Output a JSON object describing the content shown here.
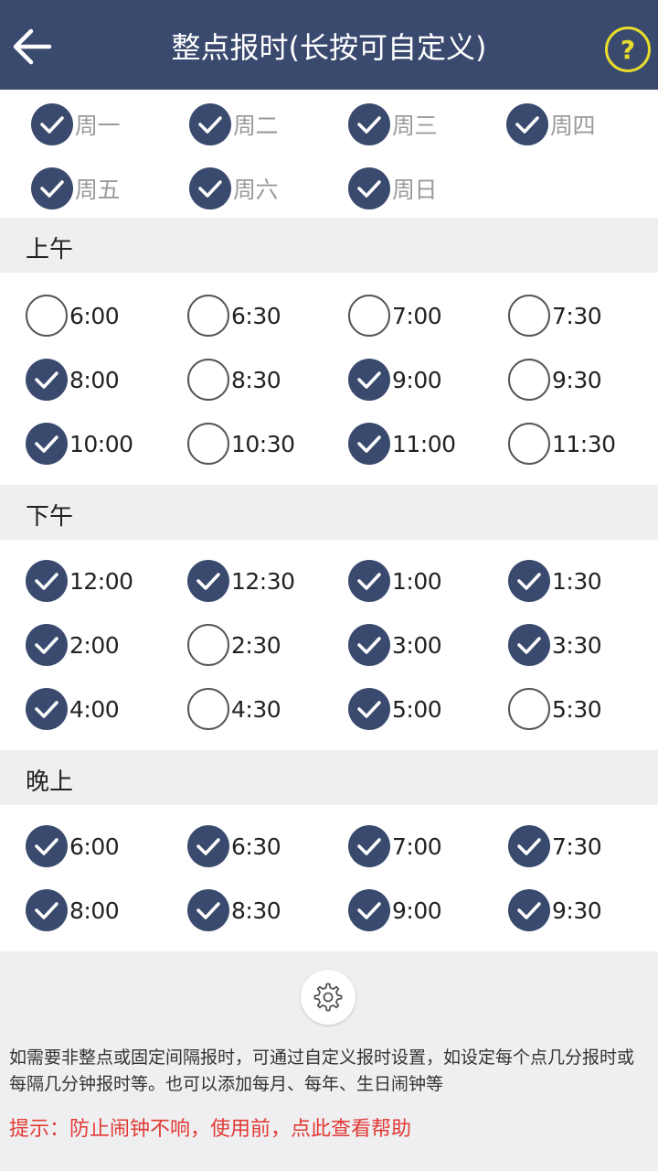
{
  "header": {
    "title": "整点报时(长按可自定义)",
    "help_label": "?"
  },
  "days": [
    {
      "label": "周一",
      "checked": true
    },
    {
      "label": "周二",
      "checked": true
    },
    {
      "label": "周三",
      "checked": true
    },
    {
      "label": "周四",
      "checked": true
    },
    {
      "label": "周五",
      "checked": true
    },
    {
      "label": "周六",
      "checked": true
    },
    {
      "label": "周日",
      "checked": true
    }
  ],
  "sections": [
    {
      "title": "上午",
      "times": [
        {
          "label": "6:00",
          "checked": false
        },
        {
          "label": "6:30",
          "checked": false
        },
        {
          "label": "7:00",
          "checked": false
        },
        {
          "label": "7:30",
          "checked": false
        },
        {
          "label": "8:00",
          "checked": true
        },
        {
          "label": "8:30",
          "checked": false
        },
        {
          "label": "9:00",
          "checked": true
        },
        {
          "label": "9:30",
          "checked": false
        },
        {
          "label": "10:00",
          "checked": true
        },
        {
          "label": "10:30",
          "checked": false
        },
        {
          "label": "11:00",
          "checked": true
        },
        {
          "label": "11:30",
          "checked": false
        }
      ]
    },
    {
      "title": "下午",
      "times": [
        {
          "label": "12:00",
          "checked": true
        },
        {
          "label": "12:30",
          "checked": true
        },
        {
          "label": "1:00",
          "checked": true
        },
        {
          "label": "1:30",
          "checked": true
        },
        {
          "label": "2:00",
          "checked": true
        },
        {
          "label": "2:30",
          "checked": false
        },
        {
          "label": "3:00",
          "checked": true
        },
        {
          "label": "3:30",
          "checked": true
        },
        {
          "label": "4:00",
          "checked": true
        },
        {
          "label": "4:30",
          "checked": false
        },
        {
          "label": "5:00",
          "checked": true
        },
        {
          "label": "5:30",
          "checked": false
        }
      ]
    },
    {
      "title": "晚上",
      "times": [
        {
          "label": "6:00",
          "checked": true
        },
        {
          "label": "6:30",
          "checked": true
        },
        {
          "label": "7:00",
          "checked": true
        },
        {
          "label": "7:30",
          "checked": true
        },
        {
          "label": "8:00",
          "checked": true
        },
        {
          "label": "8:30",
          "checked": true
        },
        {
          "label": "9:00",
          "checked": true
        },
        {
          "label": "9:30",
          "checked": true
        }
      ]
    }
  ],
  "footer": {
    "description": "如需要非整点或固定间隔报时，可通过自定义报时设置，如设定每个点几分报时或每隔几分钟报时等。也可以添加每月、每年、生日闹钟等",
    "tip": "提示：防止闹钟不响，使用前，点此查看帮助"
  },
  "colors": {
    "header_bg": "#3a4a6e",
    "checked": "#3a4a6e",
    "help_accent": "#e8dc2c",
    "tip": "#e23a34"
  }
}
